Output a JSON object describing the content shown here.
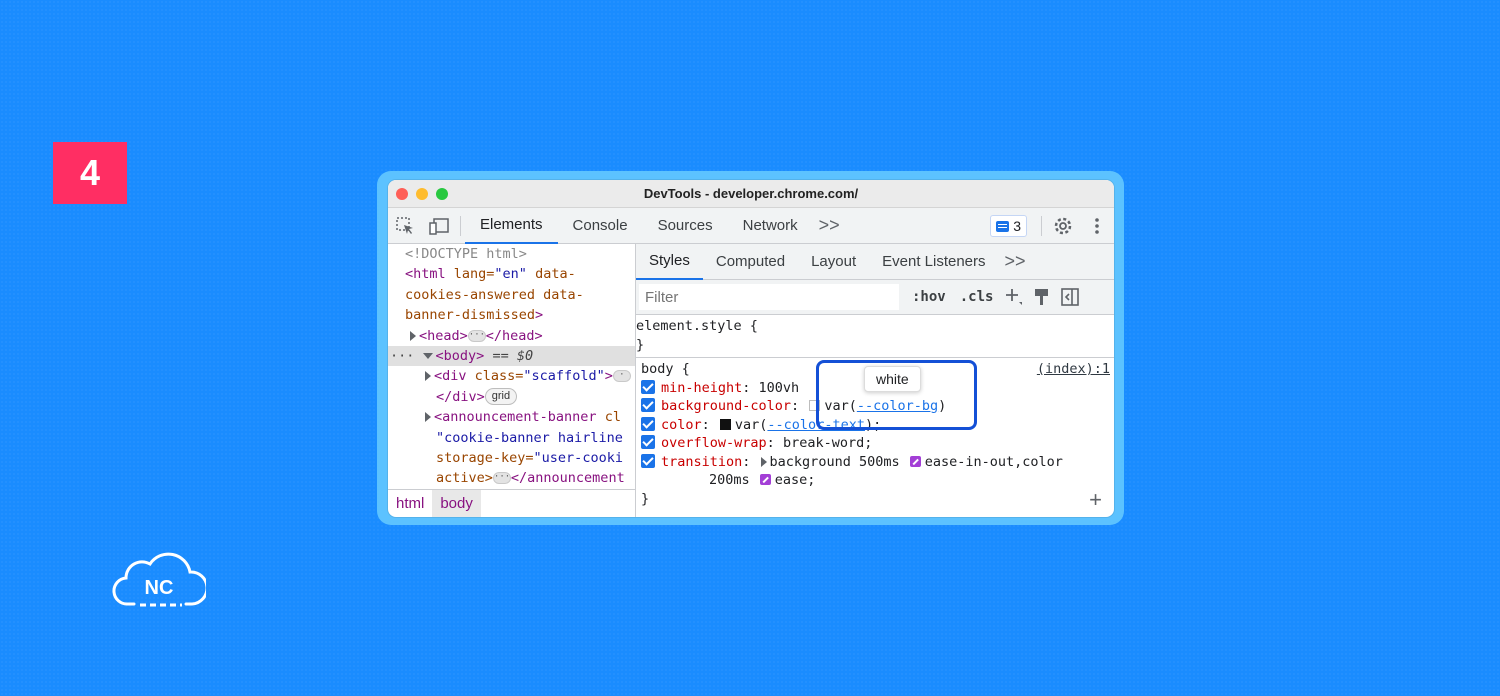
{
  "step_number": "4",
  "logo_text": "NC",
  "window_title": "DevTools - developer.chrome.com/",
  "main_tabs": [
    "Elements",
    "Console",
    "Sources",
    "Network"
  ],
  "more_tabs": ">>",
  "issues_count": "3",
  "dom_tree": {
    "doctype": "<!DOCTYPE html>",
    "html_open_tag": "<html",
    "html_lang_attr": " lang=",
    "html_lang_val": "\"en\"",
    "html_attr_a": " data-",
    "html_attr_b": "cookies-answered data-",
    "html_attr_c": "banner-dismissed",
    "html_close": ">",
    "head": "<head>",
    "head_close": "</head>",
    "body_prefix": "···",
    "body": "<body>",
    "body_eq": " == $0",
    "div_open": "<div",
    "div_class_attr": " class=",
    "div_class_val": "\"scaffold\"",
    "div_gt": ">",
    "div_close": "</div>",
    "grid_badge": "grid",
    "ann_open": "<announcement-banner",
    "ann_cl": " cl",
    "ann_val": "\"cookie-banner hairline",
    "ann_storage": "storage-key=",
    "ann_storage_val": "\"user-cooki",
    "ann_active": "active>",
    "ann_close": "</announcement"
  },
  "breadcrumbs": [
    "html",
    "body"
  ],
  "styles_tabs": [
    "Styles",
    "Computed",
    "Layout",
    "Event Listeners"
  ],
  "filter_placeholder": "Filter",
  "hov": ":hov",
  "cls": ".cls",
  "element_style": {
    "selector": "element.style {",
    "close": "}"
  },
  "body_rule": {
    "selector": "body {",
    "source": "(index):1",
    "close": "}",
    "min_height": {
      "prop": "min-height",
      "value": "100vh"
    },
    "background_color": {
      "prop": "background-color",
      "var_open": "var(",
      "var_name": "--color-bg",
      "var_close": ")"
    },
    "color": {
      "prop": "color",
      "var_open": "var(",
      "var_name": "--color-text",
      "var_close": ");"
    },
    "overflow_wrap": {
      "prop": "overflow-wrap",
      "value": "break-word;"
    },
    "transition": {
      "prop": "transition",
      "part1": "background 500ms",
      "part2": "ease-in-out,color",
      "part3": "200ms",
      "part4": "ease;"
    }
  },
  "tooltip": "white",
  "colors": {
    "background": "#1a8cff",
    "badge": "#ff2e63",
    "highlight": "#1450d6",
    "accent": "#1a73e8"
  }
}
